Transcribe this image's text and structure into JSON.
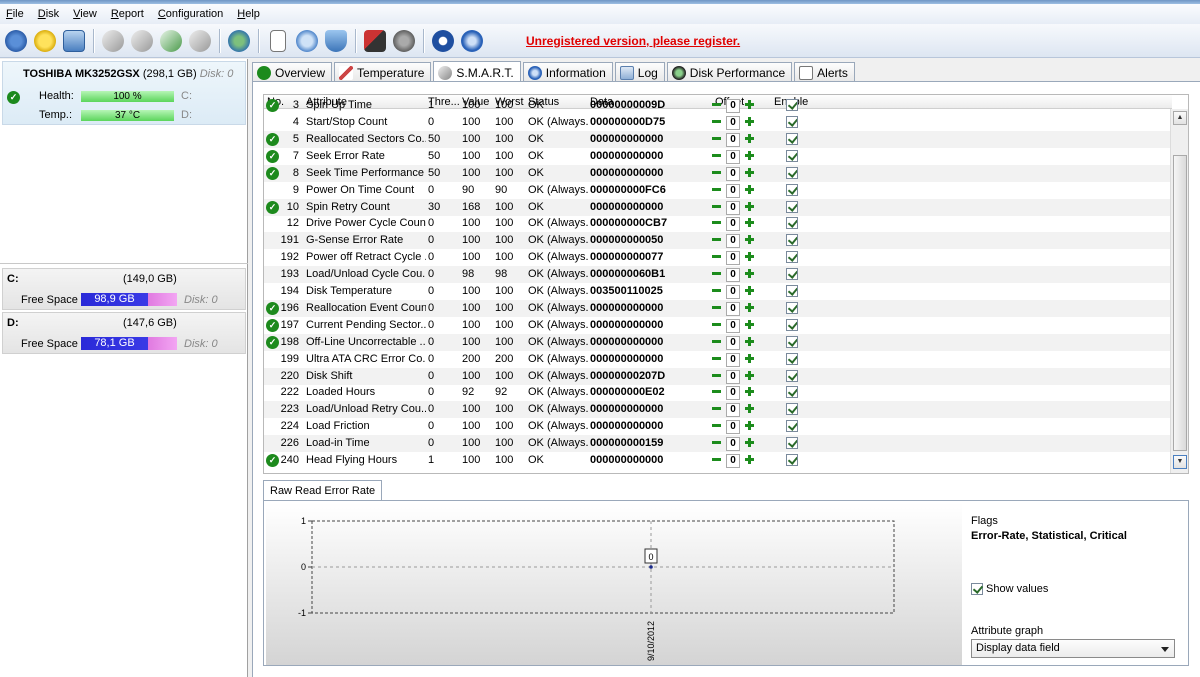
{
  "menu": [
    {
      "u": "F",
      "rest": "ile"
    },
    {
      "u": "D",
      "rest": "isk"
    },
    {
      "u": "V",
      "rest": "iew"
    },
    {
      "u": "R",
      "rest": "eport"
    },
    {
      "u": "C",
      "rest": "onfiguration"
    },
    {
      "u": "H",
      "rest": "elp"
    }
  ],
  "toolbar": {
    "register_link": "Unregistered version, please register."
  },
  "disk": {
    "model": "TOSHIBA MK3252GSX",
    "size": "(298,1 GB)",
    "disk_id": "Disk: 0",
    "health_label": "Health:",
    "health_value": "100 %",
    "health_drive": "C:",
    "temp_label": "Temp.:",
    "temp_value": "37 °C",
    "temp_drive": "D:"
  },
  "volumes": [
    {
      "name": "C:",
      "size": "(149,0 GB)",
      "free_label": "Free Space",
      "free": "98,9 GB",
      "disk": "Disk: 0",
      "fill": 0.7
    },
    {
      "name": "D:",
      "size": "(147,6 GB)",
      "free_label": "Free Space",
      "free": "78,1 GB",
      "disk": "Disk: 0",
      "fill": 0.7
    }
  ],
  "tabs": [
    "Overview",
    "Temperature",
    "S.M.A.R.T.",
    "Information",
    "Log",
    "Disk Performance",
    "Alerts"
  ],
  "table": {
    "headers": {
      "no": "No.",
      "attribute": "Attribute",
      "threshold": "Thre...",
      "value": "Value",
      "worst": "Worst",
      "status": "Status",
      "data": "Data",
      "offset": "Offset",
      "enable": "Enable"
    },
    "partial_row": {
      "no": "3",
      "attribute": "Spin Up Time",
      "threshold": "1",
      "value": "100",
      "worst": "100",
      "status": "OK",
      "data": "00000000009D"
    },
    "rows": [
      {
        "ok": false,
        "no": "4",
        "attribute": "Start/Stop Count",
        "threshold": "0",
        "value": "100",
        "worst": "100",
        "status": "OK (Always...",
        "data": "000000000D75"
      },
      {
        "ok": true,
        "no": "5",
        "attribute": "Reallocated Sectors Co...",
        "threshold": "50",
        "value": "100",
        "worst": "100",
        "status": "OK",
        "data": "000000000000"
      },
      {
        "ok": true,
        "no": "7",
        "attribute": "Seek Error Rate",
        "threshold": "50",
        "value": "100",
        "worst": "100",
        "status": "OK",
        "data": "000000000000"
      },
      {
        "ok": true,
        "no": "8",
        "attribute": "Seek Time Performance",
        "threshold": "50",
        "value": "100",
        "worst": "100",
        "status": "OK",
        "data": "000000000000"
      },
      {
        "ok": false,
        "no": "9",
        "attribute": "Power On Time Count",
        "threshold": "0",
        "value": "90",
        "worst": "90",
        "status": "OK (Always...",
        "data": "000000000FC6"
      },
      {
        "ok": true,
        "no": "10",
        "attribute": "Spin Retry Count",
        "threshold": "30",
        "value": "168",
        "worst": "100",
        "status": "OK",
        "data": "000000000000"
      },
      {
        "ok": false,
        "no": "12",
        "attribute": "Drive Power Cycle Count",
        "threshold": "0",
        "value": "100",
        "worst": "100",
        "status": "OK (Always...",
        "data": "000000000CB7"
      },
      {
        "ok": false,
        "no": "191",
        "attribute": "G-Sense Error Rate",
        "threshold": "0",
        "value": "100",
        "worst": "100",
        "status": "OK (Always...",
        "data": "000000000050"
      },
      {
        "ok": false,
        "no": "192",
        "attribute": "Power off Retract Cycle ...",
        "threshold": "0",
        "value": "100",
        "worst": "100",
        "status": "OK (Always...",
        "data": "000000000077"
      },
      {
        "ok": false,
        "no": "193",
        "attribute": "Load/Unload Cycle Cou...",
        "threshold": "0",
        "value": "98",
        "worst": "98",
        "status": "OK (Always...",
        "data": "0000000060B1"
      },
      {
        "ok": false,
        "no": "194",
        "attribute": "Disk Temperature",
        "threshold": "0",
        "value": "100",
        "worst": "100",
        "status": "OK (Always...",
        "data": "003500110025"
      },
      {
        "ok": true,
        "no": "196",
        "attribute": "Reallocation Event Count",
        "threshold": "0",
        "value": "100",
        "worst": "100",
        "status": "OK (Always...",
        "data": "000000000000"
      },
      {
        "ok": true,
        "no": "197",
        "attribute": "Current Pending Sector...",
        "threshold": "0",
        "value": "100",
        "worst": "100",
        "status": "OK (Always...",
        "data": "000000000000"
      },
      {
        "ok": true,
        "no": "198",
        "attribute": "Off-Line Uncorrectable ...",
        "threshold": "0",
        "value": "100",
        "worst": "100",
        "status": "OK (Always...",
        "data": "000000000000"
      },
      {
        "ok": false,
        "no": "199",
        "attribute": "Ultra ATA CRC Error Co...",
        "threshold": "0",
        "value": "200",
        "worst": "200",
        "status": "OK (Always...",
        "data": "000000000000"
      },
      {
        "ok": false,
        "no": "220",
        "attribute": "Disk Shift",
        "threshold": "0",
        "value": "100",
        "worst": "100",
        "status": "OK (Always...",
        "data": "00000000207D"
      },
      {
        "ok": false,
        "no": "222",
        "attribute": "Loaded Hours",
        "threshold": "0",
        "value": "92",
        "worst": "92",
        "status": "OK (Always...",
        "data": "000000000E02"
      },
      {
        "ok": false,
        "no": "223",
        "attribute": "Load/Unload Retry Cou...",
        "threshold": "0",
        "value": "100",
        "worst": "100",
        "status": "OK (Always...",
        "data": "000000000000"
      },
      {
        "ok": false,
        "no": "224",
        "attribute": "Load Friction",
        "threshold": "0",
        "value": "100",
        "worst": "100",
        "status": "OK (Always...",
        "data": "000000000000"
      },
      {
        "ok": false,
        "no": "226",
        "attribute": "Load-in Time",
        "threshold": "0",
        "value": "100",
        "worst": "100",
        "status": "OK (Always...",
        "data": "000000000159"
      },
      {
        "ok": true,
        "no": "240",
        "attribute": "Head Flying Hours",
        "threshold": "1",
        "value": "100",
        "worst": "100",
        "status": "OK",
        "data": "000000000000"
      }
    ],
    "offset_value": "0"
  },
  "graph": {
    "tab": "Raw Read Error Rate",
    "flags_label": "Flags",
    "flags_value": "Error-Rate, Statistical, Critical",
    "show_values_label": "Show values",
    "attr_graph_label": "Attribute graph",
    "attr_graph_value": "Display data field"
  },
  "chart_data": {
    "type": "line",
    "x": [
      "9/10/2012"
    ],
    "series": [
      {
        "values": [
          0
        ]
      }
    ],
    "ylim": [
      -1,
      1
    ],
    "yticks": [
      "1",
      "0",
      "-1"
    ],
    "point_labels": [
      "0"
    ],
    "grid": true
  }
}
